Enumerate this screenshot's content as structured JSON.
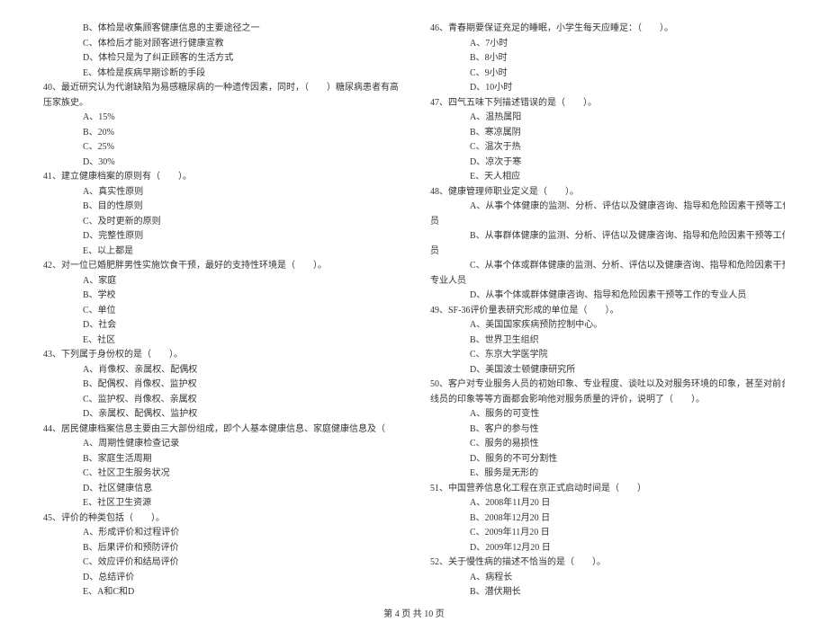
{
  "left": {
    "pre_opts": [
      "B、体检是收集顾客健康信息的主要途径之一",
      "C、体检后才能对顾客进行健康宣教",
      "D、体检只是为了纠正顾客的生活方式",
      "E、体检是疾病早期诊断的手段"
    ],
    "q40": {
      "stem1": "40、最近研究认为代谢缺陷为易感糖尿病的一种遗传因素，同时，（　　）糖尿病患者有高血",
      "stem2": "压家族史。",
      "opts": [
        "A、15%",
        "B、20%",
        "C、25%",
        "D、30%"
      ]
    },
    "q41": {
      "stem": "41、建立健康档案的原则有（　　）。",
      "opts": [
        "A、真实性原则",
        "B、目的性原则",
        "C、及时更新的原则",
        "D、完整性原则",
        "E、以上都是"
      ]
    },
    "q42": {
      "stem": "42、对一位已婚肥胖男性实施饮食干预，最好的支持性环境是（　　）。",
      "opts": [
        "A、家庭",
        "B、学校",
        "C、单位",
        "D、社会",
        "E、社区"
      ]
    },
    "q43": {
      "stem": "43、下列属于身份权的是（　　）。",
      "opts": [
        "A、肖像权、亲属权、配偶权",
        "B、配偶权、肖像权、监护权",
        "C、监护权、肖像权、亲属权",
        "D、亲属权、配偶权、监护权"
      ]
    },
    "q44": {
      "stem": "44、居民健康档案信息主要由三大部份组成，即个人基本健康信息、家庭健康信息及（　　）",
      "opts": [
        "A、周期性健康检查记录",
        "B、家庭生活周期",
        "C、社区卫生服务状况",
        "D、社区健康信息",
        "E、社区卫生资源"
      ]
    },
    "q45": {
      "stem": "45、评价的种类包括（　　）。",
      "opts": [
        "A、形成评价和过程评价",
        "B、后果评价和预防评价",
        "C、效应评价和结局评价",
        "D、总结评价",
        "E、A和C和D"
      ]
    }
  },
  "right": {
    "q46": {
      "stem": "46、青春期要保证充足的睡眠，小学生每天应睡足：（　　）。",
      "opts": [
        "A、7小时",
        "B、8小时",
        "C、9小时",
        "D、10小时"
      ]
    },
    "q47": {
      "stem": "47、四气五味下列描述错误的是（　　）。",
      "opts": [
        "A、温热属阳",
        "B、寒凉属阴",
        "C、温次于热",
        "D、凉次于寒",
        "E、天人相应"
      ]
    },
    "q48": {
      "stem": "48、健康管理师职业定义是（　　）。",
      "opts": [
        "A、从事个体健康的监测、分析、评估以及健康咨询、指导和危险因素干预等工作的专业人",
        "B、从事群体健康的监测、分析、评估以及健康咨询、指导和危险因素干预等工作的专业人",
        "C、从事个体或群体健康的监测、分析、评估以及健康咨询、指导和危险因素干预等工作的",
        "D、从事个体或群体健康咨询、指导和危险因素干预等工作的专业人员"
      ],
      "cont": [
        "员",
        "员",
        "专业人员"
      ]
    },
    "q49": {
      "stem": "49、SF-36评价量表研究形成的单位是（　　）。",
      "opts": [
        "A、美国国家疾病预防控制中心。",
        "B、世界卫生组织",
        "C、东京大学医学院",
        "D、美国波士顿健康研究所"
      ]
    },
    "q50": {
      "stem1": "50、客户对专业服务人员的初始印象、专业程度、谈吐以及对服务环境的印象，甚至对前台接",
      "stem2": "线员的印象等等方面都会影响他对服务质量的评价，说明了（　　）。",
      "opts": [
        "A、服务的可变性",
        "B、客户的参与性",
        "C、服务的易损性",
        "D、服务的不可分割性",
        "E、服务是无形的"
      ]
    },
    "q51": {
      "stem": "51、中国营养信息化工程在京正式启动时间是（　　）",
      "opts": [
        "A、2008年11月20 日",
        "B、2008年12月20 日",
        "C、2009年11月20 日",
        "D、2009年12月20 日"
      ]
    },
    "q52": {
      "stem": "52、关于慢性病的描述不恰当的是（　　）。",
      "opts": [
        "A、病程长",
        "B、潜伏期长"
      ]
    }
  },
  "footer": "第 4 页 共 10 页"
}
